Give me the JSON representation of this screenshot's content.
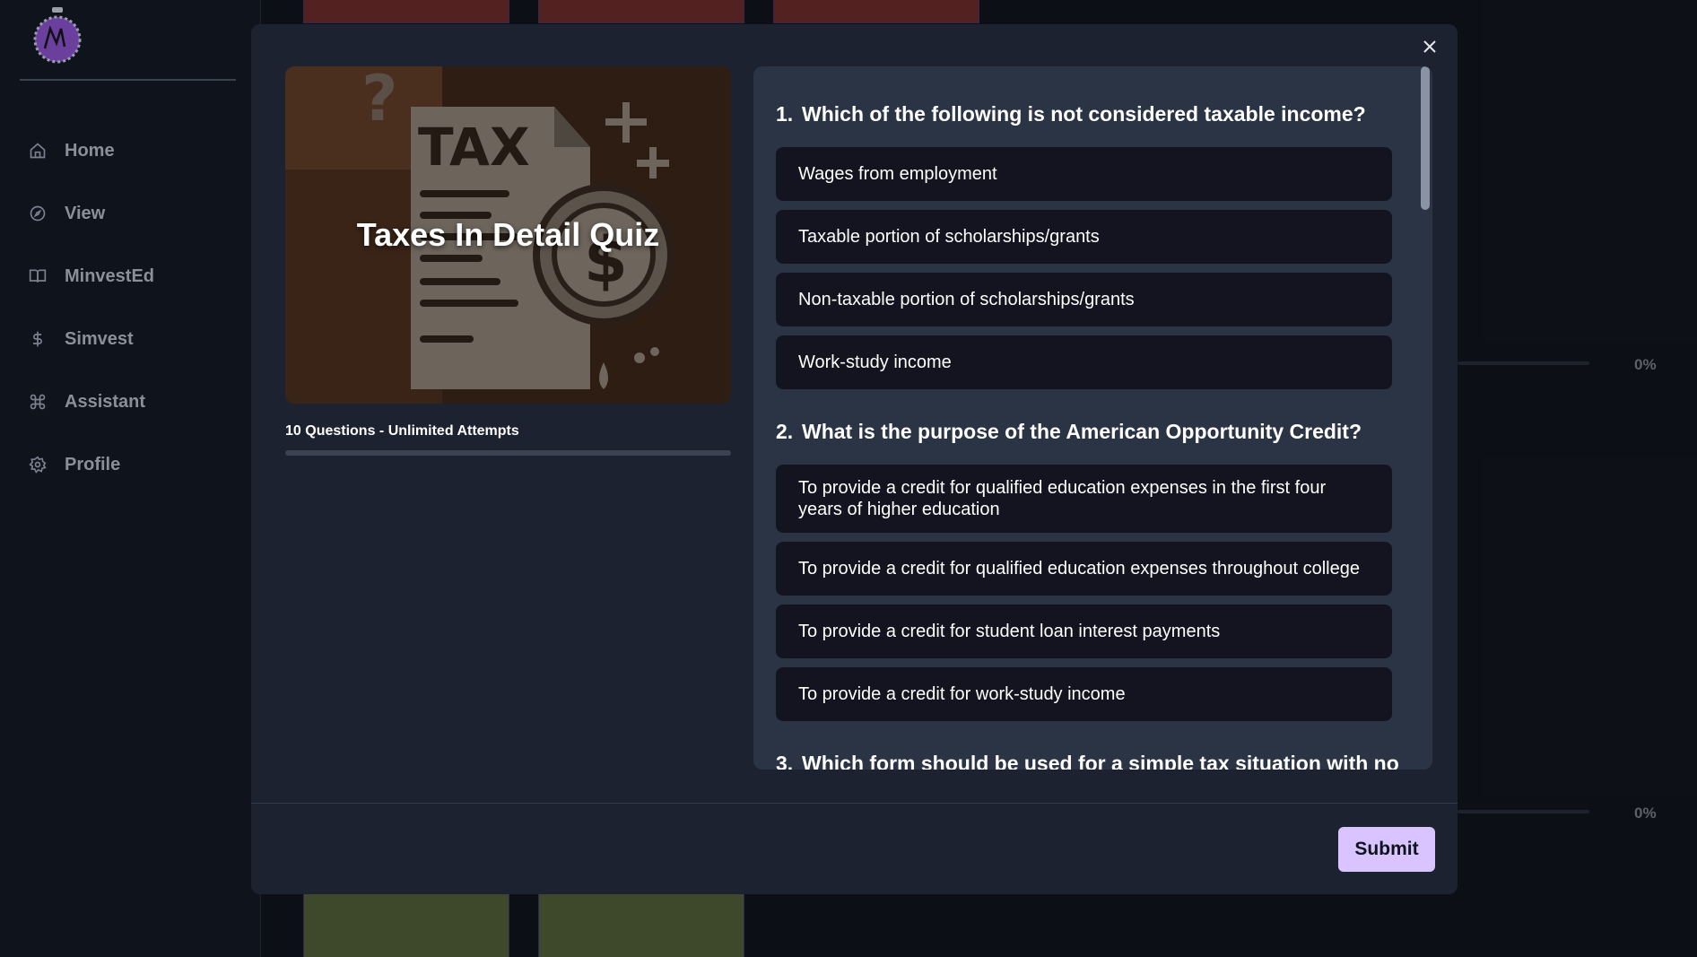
{
  "sidebar": {
    "logo_alt": "M",
    "items": [
      {
        "label": "Home",
        "icon": "home-icon"
      },
      {
        "label": "View",
        "icon": "compass-icon"
      },
      {
        "label": "MinvestEd",
        "icon": "book-icon"
      },
      {
        "label": "Simvest",
        "icon": "dollar-icon"
      },
      {
        "label": "Assistant",
        "icon": "command-icon"
      },
      {
        "label": "Profile",
        "icon": "gear-icon"
      }
    ]
  },
  "background": {
    "progress_1_pct": "0%",
    "progress_2_pct": "0%"
  },
  "modal": {
    "title": "Taxes In Detail Quiz",
    "meta": "10 Questions - Unlimited Attempts",
    "progress": 0,
    "submit_label": "Submit",
    "questions": [
      {
        "number": "1.",
        "text": "Which of the following is not considered taxable income?",
        "options": [
          "Wages from employment",
          "Taxable portion of scholarships/grants",
          "Non-taxable portion of scholarships/grants",
          "Work-study income"
        ]
      },
      {
        "number": "2.",
        "text": "What is the purpose of the American Opportunity Credit?",
        "options": [
          "To provide a credit for qualified education expenses in the first four years of higher education",
          "To provide a credit for qualified education expenses throughout college",
          "To provide a credit for student loan interest payments",
          "To provide a credit for work-study income"
        ]
      },
      {
        "number": "3.",
        "text": "Which form should be used for a simple tax situation with no",
        "options": []
      }
    ]
  },
  "colors": {
    "accent": "#d9c4ff",
    "modal_bg": "#1c2230",
    "panel_bg": "#2b3444",
    "option_bg": "#131420"
  }
}
